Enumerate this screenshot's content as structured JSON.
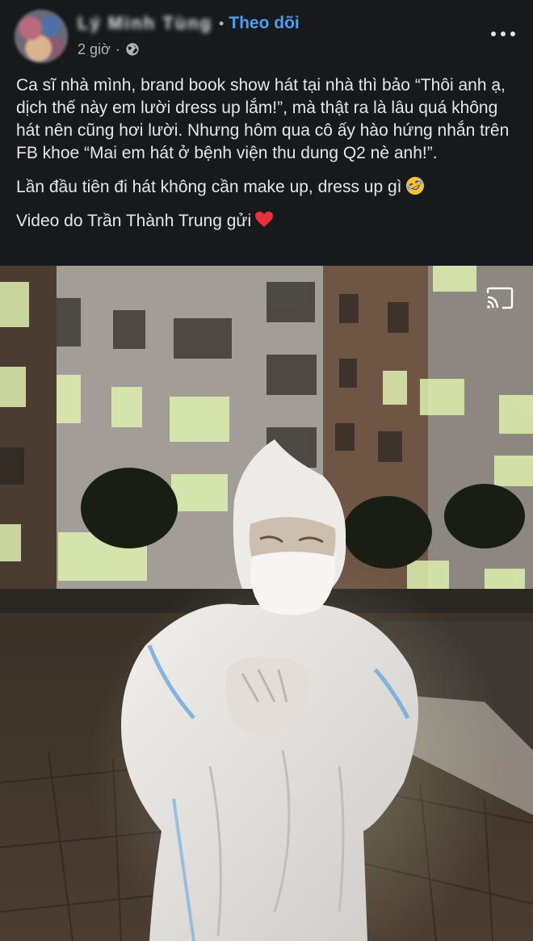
{
  "header": {
    "author_name": "Lý Minh Tùng",
    "follow_label": "Theo dõi",
    "time": "2 giờ",
    "privacy_icon": "globe-icon",
    "more_icon": "more-horizontal-icon"
  },
  "post": {
    "paragraphs": [
      "Ca sĩ nhà mình, brand book show hát tại nhà thì bảo “Thôi anh ạ, dịch thế này em lười dress up lắm!”, mà thật ra là lâu quá không hát nên cũng hơi lười. Nhưng hôm qua cô ấy hào hứng nhắn trên FB khoe “Mai em hát ở bệnh viện thu dung Q2 nè anh!”.",
      "Lần đầu tiên đi hát không cần make up, dress up gì",
      "Video do Trần Thành Trung gửi"
    ],
    "emoji": [
      "rolling-laughing-emoji",
      "red-heart-emoji"
    ]
  },
  "media": {
    "cast_icon": "cast-icon"
  },
  "colors": {
    "background": "#18191a",
    "text": "#e4e6eb",
    "secondary_text": "#b0b3b8",
    "accent": "#4a9ff5"
  }
}
